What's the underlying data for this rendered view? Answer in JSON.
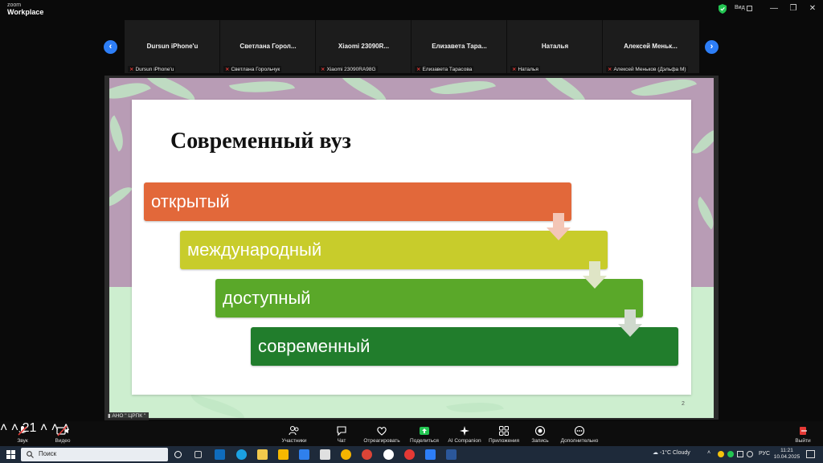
{
  "app": {
    "brand_top": "zoom",
    "brand_bottom": "Workplace"
  },
  "window": {
    "view_label": "Вид",
    "minimize": "—",
    "restore": "❐",
    "close": "✕"
  },
  "participants": [
    {
      "tile_name": "Dursun iPhone'u",
      "label": "Dursun iPhone'u"
    },
    {
      "tile_name": "Светлана  Горол...",
      "label": "Светлана Горольчук"
    },
    {
      "tile_name": "Xiaomi  23090R...",
      "label": "Xiaomi 23090RA98G"
    },
    {
      "tile_name": "Елизавета  Тара...",
      "label": "Елизавета Тарасова"
    },
    {
      "tile_name": "Наталья",
      "label": "Наталья"
    },
    {
      "tile_name": "Алексей  Меньк...",
      "label": "Алексей Меньков (Дэльфа М)"
    }
  ],
  "nav": {
    "prev": "‹",
    "next": "›"
  },
  "slide": {
    "title": "Современный вуз",
    "steps": [
      {
        "text": "открытый",
        "color": "#e2683a"
      },
      {
        "text": "международный",
        "color": "#c8cc2b"
      },
      {
        "text": "доступный",
        "color": "#5aa829"
      },
      {
        "text": "современный",
        "color": "#217d2c"
      }
    ],
    "page_number": "2"
  },
  "presenter_tag": "АНО \" ЦРПК \"",
  "toolbar": {
    "audio": "Звук",
    "video": "Видео",
    "participants": "Участники",
    "participants_count": "21",
    "chat": "Чат",
    "react": "Отреагировать",
    "share": "Поделиться",
    "ai": "AI Companion",
    "apps": "Приложения",
    "record": "Запись",
    "more": "Дополнительно",
    "leave": "Выйти"
  },
  "taskbar": {
    "search_placeholder": "Поиск",
    "weather": "-1°C  Cloudy",
    "language": "РУС",
    "time": "11:21",
    "date": "10.04.2025"
  },
  "colors": {
    "accent": "#2d7ef7",
    "muted_mic": "#e53935",
    "share_green": "#23c552"
  }
}
